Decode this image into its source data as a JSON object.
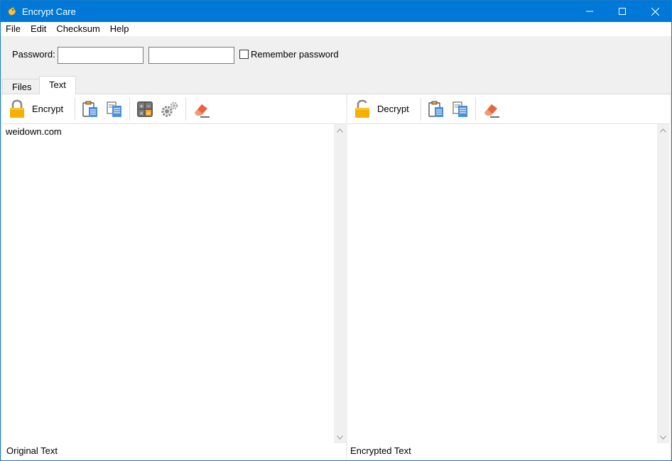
{
  "window": {
    "title": "Encrypt Care",
    "icon": "app-logo-icon",
    "controls": [
      "minimize-icon",
      "maximize-icon",
      "close-icon"
    ]
  },
  "menu": [
    "File",
    "Edit",
    "Checksum",
    "Help"
  ],
  "password": {
    "label": "Password:",
    "value1": "",
    "value2": "",
    "remember_label": "Remember password",
    "remember_checked": false
  },
  "tabs": [
    {
      "label": "Files",
      "active": false
    },
    {
      "label": "Text",
      "active": true
    }
  ],
  "left_panel": {
    "action_label": "Encrypt",
    "toolbar_icons": [
      "lock-icon",
      "paste-icon",
      "copy-icon",
      "calculator-icon",
      "settings-icon",
      "eraser-icon"
    ],
    "text": "weidown.com",
    "status": "Original Text"
  },
  "right_panel": {
    "action_label": "Decrypt",
    "toolbar_icons": [
      "unlock-icon",
      "paste-icon",
      "copy-icon",
      "eraser-icon"
    ],
    "text": "",
    "status": "Encrypted Text"
  },
  "colors": {
    "titlebar": "#0078d7",
    "window_bg": "#f0f0f0",
    "lock": "#f5b000",
    "doc_blue": "#4a90d9",
    "eraser": "#e8643a"
  }
}
